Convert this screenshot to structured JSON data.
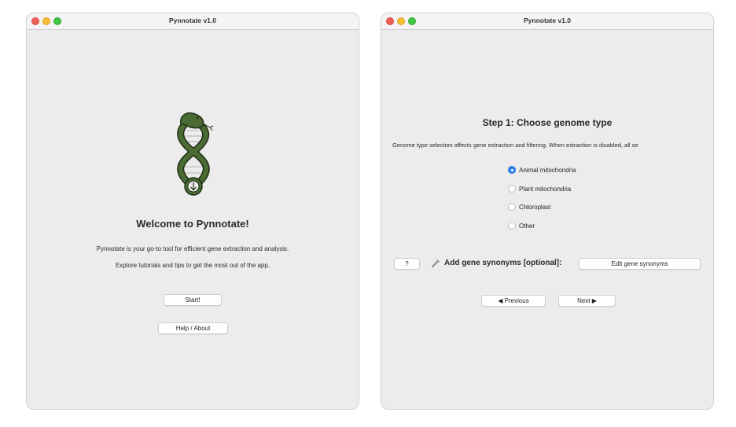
{
  "left_window": {
    "title": "Pynnotate v1.0",
    "logo_icon": "snake-dna-helix-logo",
    "heading": "Welcome to Pynnotate!",
    "line1": "Pynnotate is your go-to tool for efficient gene extraction and analysis.",
    "line2": "Explore tutorials and tips to get the most out of the app.",
    "start_label": "Start!",
    "help_label": "Help / About"
  },
  "right_window": {
    "title": "Pynnotate v1.0",
    "heading": "Step 1: Choose genome type",
    "description": "Genome type selection affects gene extraction and filtering. When extraction is disabled, all se",
    "options": [
      {
        "label": "Animal mitochondria",
        "selected": true
      },
      {
        "label": "Plant mitochondria",
        "selected": false
      },
      {
        "label": "Chloroplast",
        "selected": false
      },
      {
        "label": "Other",
        "selected": false
      }
    ],
    "help_button_label": "?",
    "synonyms_icon": "wrench-icon",
    "synonyms_label": "Add gene synonyms [optional]:",
    "edit_synonyms_label": "Edit gene synonyms",
    "previous_label": "◀ Previous",
    "next_label": "Next ▶"
  },
  "colors": {
    "window_bg": "#ececec",
    "titlebar_bg": "#f6f3f6",
    "radio_selected": "#2f7ff1",
    "logo_green": "#4a6b34",
    "logo_outline": "#1f2f17"
  }
}
